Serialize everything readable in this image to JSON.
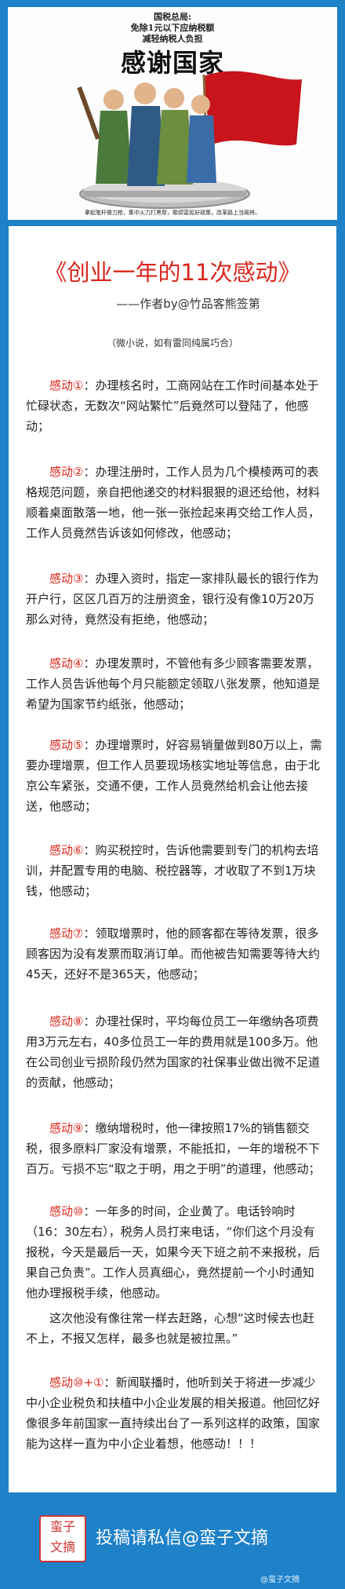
{
  "poster": {
    "line1": "国税总局:",
    "line2": "免除1元以下应纳税额",
    "line3": "减轻纳税人负担",
    "title": "感谢国家",
    "caption": "拿起笔杆做刀枪，集中火力打黑帮，歌颂富民好政策，改革路上当阁将。"
  },
  "article": {
    "title": "《创业一年的11次感动》",
    "author": "——作者by@竹品客熊签第",
    "note": "（微小说，如有雷同纯属巧合）",
    "paragraphs": [
      {
        "label": "感动①",
        "text": "：办理核名时，工商网站在工作时间基本处于忙碌状态，无数次“网站繁忙”后竟然可以登陆了，他感动；"
      },
      {
        "label": "感动②",
        "text": "：办理注册时，工作人员为几个模棱两可的表格规范问题，亲自把他递交的材料狠狠的退还给他，材料顺着桌面散落一地，他一张一张捡起来再交给工作人员，工作人员竟然告诉该如何修改，他感动；"
      },
      {
        "label": "感动③",
        "text": "：办理入资时，指定一家排队最长的银行作为开户行，区区几百万的注册资金，银行没有像10万20万那么对待，竟然没有拒绝，他感动；"
      },
      {
        "label": "感动④",
        "text": "：办理发票时，不管他有多少顾客需要发票，工作人员告诉他每个月只能额定领取八张发票，他知道是希望为国家节约纸张，他感动；"
      },
      {
        "label": "感动⑤",
        "text": "：办理增票时，好容易销量做到80万以上，需要办理增票，但工作人员要现场核实地址等信息，由于北京公车紧张，交通不便，工作人员竟然给机会让他去接送，他感动；"
      },
      {
        "label": "感动⑥",
        "text": "：购买税控时，告诉他需要到专门的机构去培训，并配置专用的电脑、税控器等，才收取了不到1万块钱，他感动；"
      },
      {
        "label": "感动⑦",
        "text": "：领取增票时，他的顾客都在等待发票，很多顾客因为没有发票而取消订单。而他被告知需要等待大约45天，还好不是365天，他感动；"
      },
      {
        "label": "感动⑧",
        "text": "：办理社保时，平均每位员工一年缴纳各项费用3万元左右，40多位员工一年的费用就是100多万。他在公司创业亏损阶段仍然为国家的社保事业做出微不足道的贡献，他感动；"
      },
      {
        "label": "感动⑨",
        "text": "：缴纳增税时，他一律按照17%的销售额交税，很多原料厂家没有增票，不能抵扣，一年的增税不下百万。亏损不忘“取之于明，用之于明”的道理，他感动；"
      },
      {
        "label": "感动⑩",
        "text": "：一年多的时间，企业黄了。电话铃响时（16：30左右），税务人员打来电话，“你们这个月没有报税，今天是最后一天，如果今天下班之前不来报税，后果自己负责”。工作人员真细心，竟然提前一个小时通知他办理报税手续，他感动。"
      },
      {
        "label": "",
        "text": "这次他没有像往常一样去赶路，心想“这时候去也赶不上，不报又怎样，最多也就是被拉黑。”"
      },
      {
        "label": "感动⑩+①",
        "text": "：新闻联播时，他听到关于将进一步减少中小企业税负和扶植中小企业发展的相关报道。他回忆好像很多年前国家一直持续出台了一系列这样的政策，国家能为这样一直为中小企业着想，他感动！！！"
      }
    ]
  },
  "footer": {
    "seal": "蛮子文摘",
    "text": "投稿请私信@蛮子文摘",
    "watermark": "@蛮子文摘"
  },
  "colors": {
    "background": "#1f82c9",
    "accent": "#d9261c",
    "flag": "#c8141a"
  }
}
